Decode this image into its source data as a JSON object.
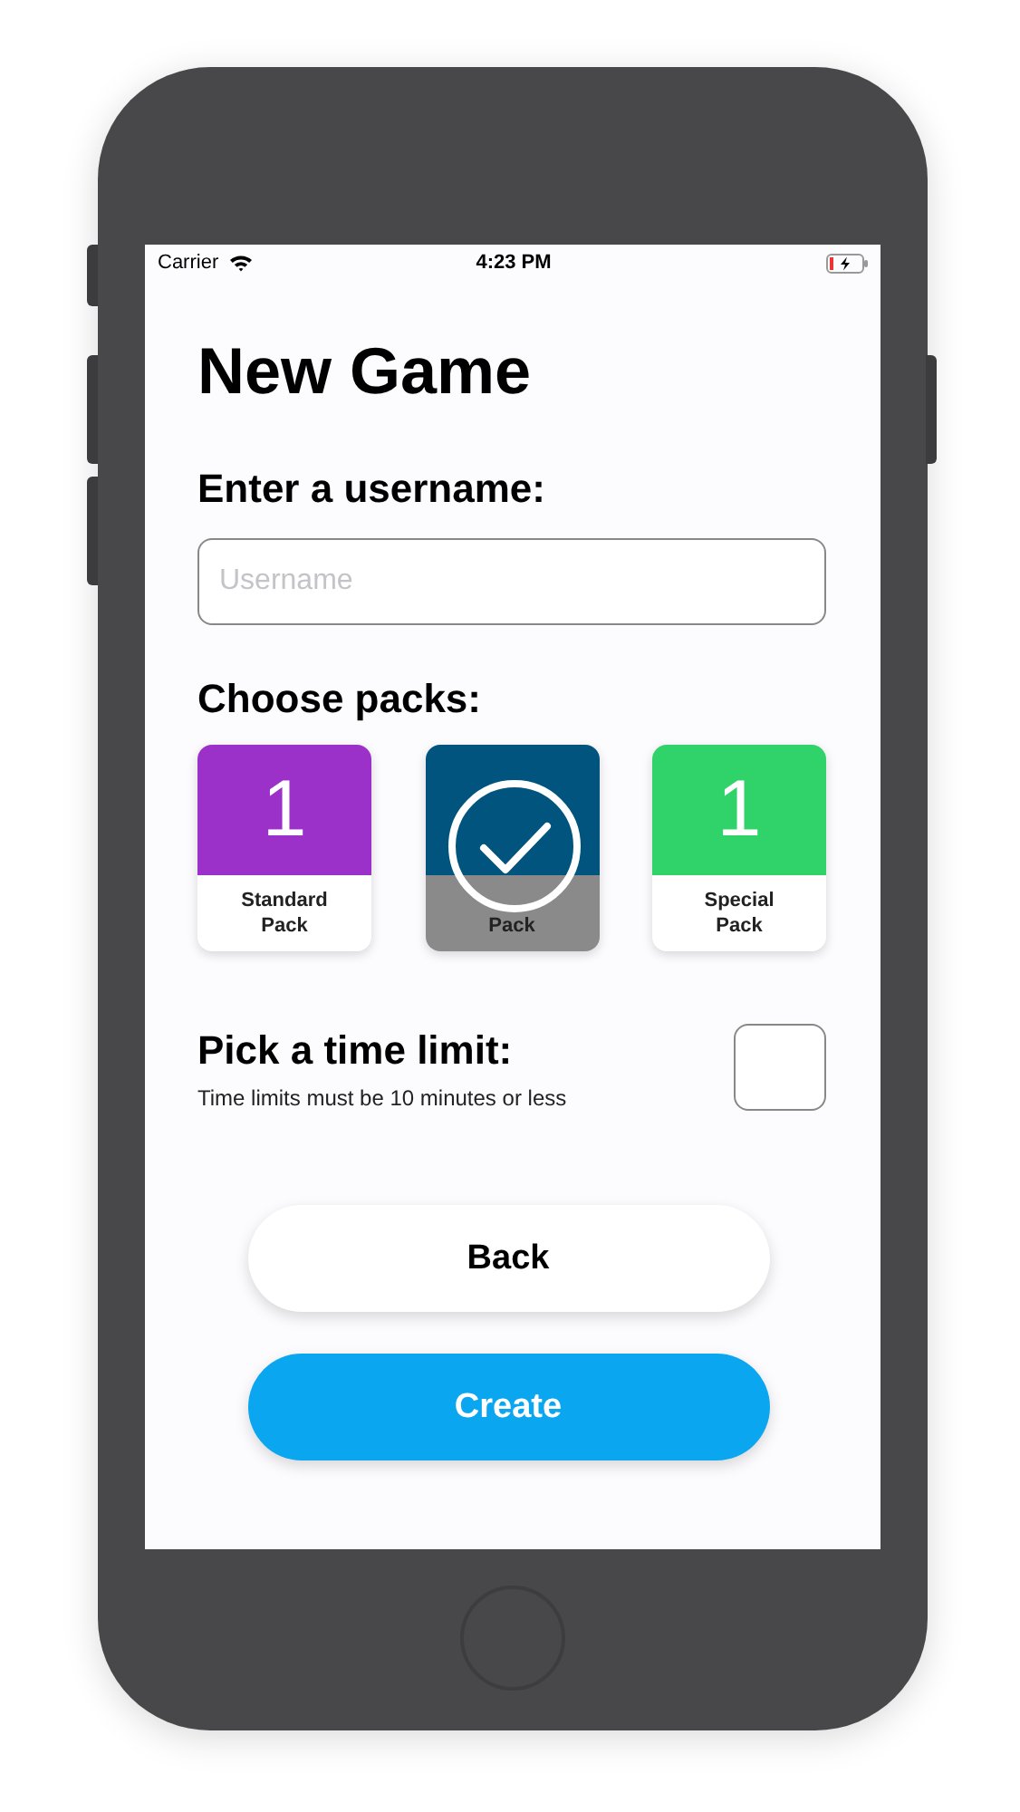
{
  "status_bar": {
    "carrier": "Carrier",
    "time": "4:23 PM",
    "charging": true
  },
  "title": "New Game",
  "username": {
    "label": "Enter a username:",
    "placeholder": "Username"
  },
  "packs": {
    "label": "Choose packs:",
    "items": [
      {
        "number": "1",
        "name": "Standard\nPack",
        "color": "#9b31c8",
        "selected": false
      },
      {
        "name": "Pack",
        "color": "#00547e",
        "selected": true
      },
      {
        "number": "1",
        "name": "Special\nPack",
        "color": "#30d36a",
        "selected": false
      }
    ]
  },
  "time_limit": {
    "label": "Pick a time limit:",
    "hint": "Time limits must be 10 minutes or less",
    "checked": false
  },
  "buttons": [
    {
      "label": "Back",
      "kind": "secondary"
    },
    {
      "label": "Create",
      "kind": "primary"
    }
  ]
}
